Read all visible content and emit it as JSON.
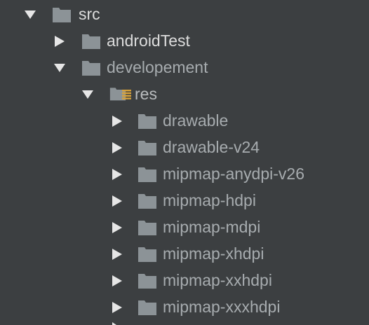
{
  "tree": {
    "items": [
      {
        "label": "src",
        "expanded": true
      },
      {
        "label": "androidTest",
        "expanded": false
      },
      {
        "label": "developement",
        "expanded": true
      },
      {
        "label": "res",
        "expanded": true,
        "icon": "resources-folder-icon"
      },
      {
        "label": "drawable",
        "expanded": false
      },
      {
        "label": "drawable-v24",
        "expanded": false
      },
      {
        "label": "mipmap-anydpi-v26",
        "expanded": false
      },
      {
        "label": "mipmap-hdpi",
        "expanded": false
      },
      {
        "label": "mipmap-mdpi",
        "expanded": false
      },
      {
        "label": "mipmap-xhdpi",
        "expanded": false
      },
      {
        "label": "mipmap-xxhdpi",
        "expanded": false
      },
      {
        "label": "mipmap-xxxhdpi",
        "expanded": false
      }
    ]
  },
  "colors": {
    "background": "#3c3f41",
    "folder": "#8c9397",
    "arrow": "#e6e6e6",
    "resource_badge": "#d9a33a"
  }
}
